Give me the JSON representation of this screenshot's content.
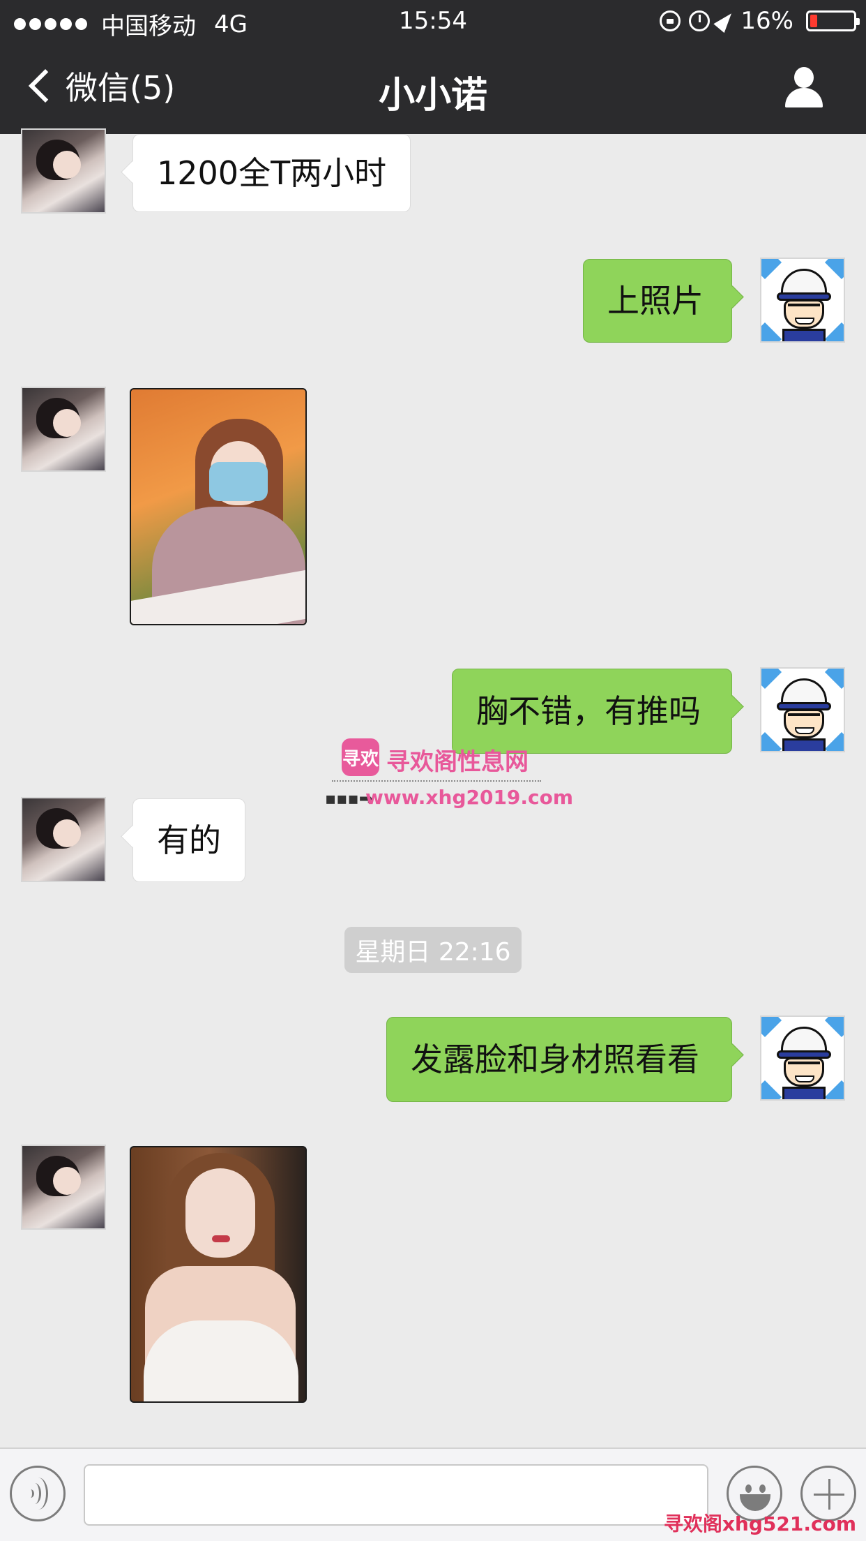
{
  "status_bar": {
    "carrier": "中国移动",
    "network": "4G",
    "time": "15:54",
    "battery_text": "16%",
    "battery_level": 0.16,
    "battery_color": "#ff3b30",
    "icons": [
      "signal-dots",
      "orientation-lock-icon",
      "alarm-icon",
      "location-arrow-icon",
      "battery-icon"
    ]
  },
  "nav": {
    "back_label": "微信(5)",
    "title": "小小诺",
    "right_icon": "person-icon"
  },
  "messages": [
    {
      "side": "left",
      "type": "text",
      "text": "1200全T两小时"
    },
    {
      "side": "right",
      "type": "text",
      "text": "上照片"
    },
    {
      "side": "left",
      "type": "image"
    },
    {
      "side": "right",
      "type": "text",
      "text": "胸不错，有推吗"
    },
    {
      "side": "left",
      "type": "text",
      "text": "有的"
    },
    {
      "type": "timestamp",
      "text": "星期日 22:16"
    },
    {
      "side": "right",
      "type": "text",
      "text": "发露脸和身材照看看"
    },
    {
      "side": "left",
      "type": "image"
    }
  ],
  "watermark": {
    "logo_text": "寻欢",
    "name": "寻欢阁性息网",
    "url": "www.xhg2019.com",
    "corner_text": "寻欢阁xhg521.com"
  },
  "input_bar": {
    "voice_icon": "voice-icon",
    "text_value": "",
    "emoji_icon": "emoji-icon",
    "plus_icon": "plus-icon"
  },
  "colors": {
    "nav_bg": "#2b2b2d",
    "chat_bg": "#ebebeb",
    "sent_bubble": "#8fd45a",
    "received_bubble": "#ffffff",
    "watermark": "#e8589a"
  }
}
